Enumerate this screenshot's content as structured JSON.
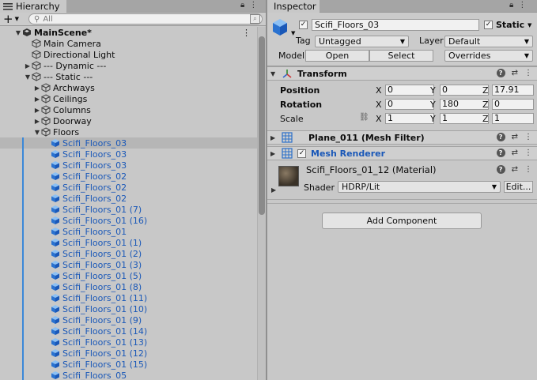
{
  "hierarchy": {
    "tab_title": "Hierarchy",
    "search_placeholder": "All",
    "add_label": "+",
    "scene_name": "MainScene*",
    "rows": [
      {
        "label": "MainScene*",
        "depth": 0,
        "expand": "open",
        "icon": "unity-scene-icon",
        "bold": true
      },
      {
        "label": "Main Camera",
        "depth": 1,
        "expand": "none",
        "icon": "gameobject-icon"
      },
      {
        "label": "Directional Light",
        "depth": 1,
        "expand": "none",
        "icon": "gameobject-icon"
      },
      {
        "label": "--- Dynamic ---",
        "depth": 1,
        "expand": "closed",
        "icon": "gameobject-icon"
      },
      {
        "label": "--- Static ---",
        "depth": 1,
        "expand": "open",
        "icon": "gameobject-icon"
      },
      {
        "label": "Archways",
        "depth": 2,
        "expand": "closed",
        "icon": "gameobject-icon"
      },
      {
        "label": "Ceilings",
        "depth": 2,
        "expand": "closed",
        "icon": "gameobject-icon"
      },
      {
        "label": "Columns",
        "depth": 2,
        "expand": "closed",
        "icon": "gameobject-icon"
      },
      {
        "label": "Doorway",
        "depth": 2,
        "expand": "closed",
        "icon": "gameobject-icon"
      },
      {
        "label": "Floors",
        "depth": 2,
        "expand": "open",
        "icon": "gameobject-icon"
      },
      {
        "label": "Scifi_Floors_03",
        "depth": 3,
        "prefab": true,
        "selected": true
      },
      {
        "label": "Scifi_Floors_03",
        "depth": 3,
        "prefab": true
      },
      {
        "label": "Scifi_Floors_03",
        "depth": 3,
        "prefab": true
      },
      {
        "label": "Scifi_Floors_02",
        "depth": 3,
        "prefab": true
      },
      {
        "label": "Scifi_Floors_02",
        "depth": 3,
        "prefab": true
      },
      {
        "label": "Scifi_Floors_02",
        "depth": 3,
        "prefab": true
      },
      {
        "label": "Scifi_Floors_01 (7)",
        "depth": 3,
        "prefab": true
      },
      {
        "label": "Scifi_Floors_01 (16)",
        "depth": 3,
        "prefab": true
      },
      {
        "label": "Scifi_Floors_01",
        "depth": 3,
        "prefab": true
      },
      {
        "label": "Scifi_Floors_01 (1)",
        "depth": 3,
        "prefab": true
      },
      {
        "label": "Scifi_Floors_01 (2)",
        "depth": 3,
        "prefab": true
      },
      {
        "label": "Scifi_Floors_01 (3)",
        "depth": 3,
        "prefab": true
      },
      {
        "label": "Scifi_Floors_01 (5)",
        "depth": 3,
        "prefab": true
      },
      {
        "label": "Scifi_Floors_01 (8)",
        "depth": 3,
        "prefab": true
      },
      {
        "label": "Scifi_Floors_01 (11)",
        "depth": 3,
        "prefab": true
      },
      {
        "label": "Scifi_Floors_01 (10)",
        "depth": 3,
        "prefab": true
      },
      {
        "label": "Scifi_Floors_01 (9)",
        "depth": 3,
        "prefab": true
      },
      {
        "label": "Scifi_Floors_01 (14)",
        "depth": 3,
        "prefab": true
      },
      {
        "label": "Scifi_Floors_01 (13)",
        "depth": 3,
        "prefab": true
      },
      {
        "label": "Scifi_Floors_01 (12)",
        "depth": 3,
        "prefab": true
      },
      {
        "label": "Scifi_Floors_01 (15)",
        "depth": 3,
        "prefab": true
      },
      {
        "label": "Scifi_Floors_05",
        "depth": 3,
        "prefab": true
      }
    ]
  },
  "inspector": {
    "tab_title": "Inspector",
    "object_name": "Scifi_Floors_03",
    "active": true,
    "static_label": "Static",
    "static_checked": true,
    "tag_label": "Tag",
    "tag_value": "Untagged",
    "layer_label": "Layer",
    "layer_value": "Default",
    "model_label": "Model",
    "open_label": "Open",
    "select_label": "Select",
    "overrides_label": "Overrides",
    "transform": {
      "title": "Transform",
      "position_label": "Position",
      "rotation_label": "Rotation",
      "scale_label": "Scale",
      "x_label": "X",
      "y_label": "Y",
      "z_label": "Z",
      "position": {
        "x": "0",
        "y": "0",
        "z": "17.91"
      },
      "rotation": {
        "x": "0",
        "y": "180",
        "z": "0"
      },
      "scale": {
        "x": "1",
        "y": "1",
        "z": "1"
      }
    },
    "mesh_filter_title": "Plane_011 (Mesh Filter)",
    "mesh_renderer_title": "Mesh Renderer",
    "material": {
      "title": "Scifi_Floors_01_12 (Material)",
      "shader_label": "Shader",
      "shader_value": "HDRP/Lit",
      "edit_label": "Edit..."
    },
    "add_component_label": "Add Component"
  },
  "colors": {
    "selection_bar": "#3b88d8",
    "prefab_text": "#1a58b8",
    "panel_bg": "#c8c8c8"
  }
}
